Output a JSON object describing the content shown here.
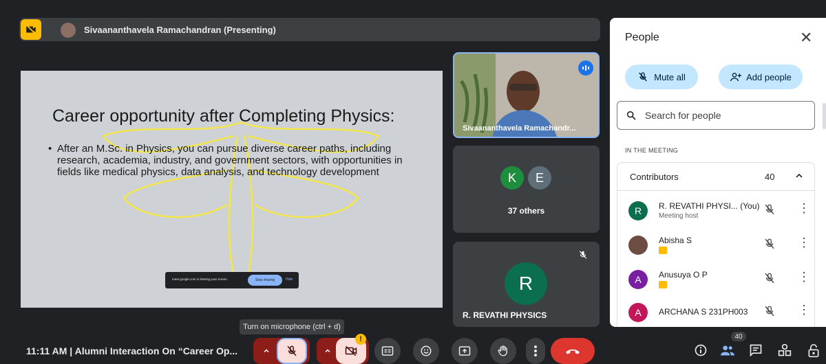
{
  "presenter_bar": {
    "name": "Sivaananthavela Ramachandran (Presenting)"
  },
  "slide": {
    "title": "Career opportunity after Completing Physics:",
    "bullet": "After an M.Sc. in Physics, you can pursue diverse career paths, including research, academia, industry, and government sectors, with opportunities in fields like medical physics, data analysis, and technology development",
    "share_text": "meet.google.com is sharing your screen.",
    "stop_sharing": "Stop sharing",
    "hide": "Hide"
  },
  "tiles": {
    "video_name": "Sivaananthavela Ramachandr...",
    "others_initials": [
      "K",
      "E"
    ],
    "others_colors": [
      "#1e8e3e",
      "#5f6f7a"
    ],
    "others_label": "37 others",
    "revathi_initial": "R",
    "revathi_name": "R. REVATHI PHYSICS"
  },
  "panel": {
    "title": "People",
    "mute_all": "Mute all",
    "add_people": "Add people",
    "search_placeholder": "Search for people",
    "section_label": "IN THE MEETING",
    "contributors_label": "Contributors",
    "contributors_count": "40",
    "participants": [
      {
        "initial": "R",
        "name": "R. REVATHI PHYSI...  (You)",
        "sub": "Meeting host",
        "color": "#0b6e4f",
        "presenting": false
      },
      {
        "initial": "",
        "name": "Abisha S",
        "sub": "",
        "color": "#6d4c41",
        "presenting": true
      },
      {
        "initial": "A",
        "name": "Anusuya O P",
        "sub": "",
        "color": "#7b1fa2",
        "presenting": true
      },
      {
        "initial": "A",
        "name": "ARCHANA S 231PH003",
        "sub": "",
        "color": "#c2185b",
        "presenting": false
      }
    ]
  },
  "bottom": {
    "clock_meeting": "11:11 AM  |  Alumni Interaction On “Career Op...",
    "tooltip": "Turn on microphone (ctrl + d)",
    "camera_warning": "!",
    "people_count": "40"
  }
}
